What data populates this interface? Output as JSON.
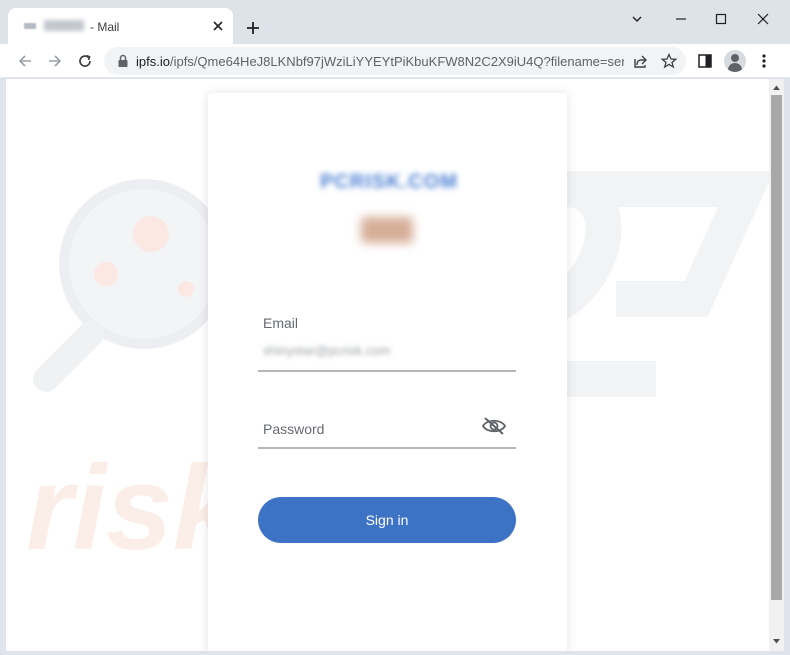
{
  "browser": {
    "tab": {
      "title": "- Mail",
      "close_icon": "close-icon",
      "new_tab_icon": "plus-icon"
    },
    "window_controls": [
      "minimize-icon",
      "maximize-icon",
      "close-icon"
    ],
    "url": {
      "host": "ipfs.io",
      "path": "/ipfs/Qme64HeJ8LKNbf97jWziLiYYEYtPiKbuKFW8N2C2X9iU4Q?filename=servi..."
    },
    "toolbar_icons": [
      "back-arrow-icon",
      "forward-arrow-icon",
      "reload-icon",
      "lock-icon",
      "share-icon",
      "star-icon",
      "side-panel-icon",
      "profile-icon",
      "more-menu-icon"
    ]
  },
  "login": {
    "brand_blurred": "PCRISK.COM",
    "email_label": "Email",
    "email_value_blurred": "shinystar@pcrisk.com",
    "password_label": "Password",
    "password_toggle_icon": "eye-off-icon",
    "signin_label": "Sign in"
  },
  "colors": {
    "button": "#3d73c5",
    "brand": "#4a7fd3",
    "chrome_frame": "#dee3ea"
  }
}
